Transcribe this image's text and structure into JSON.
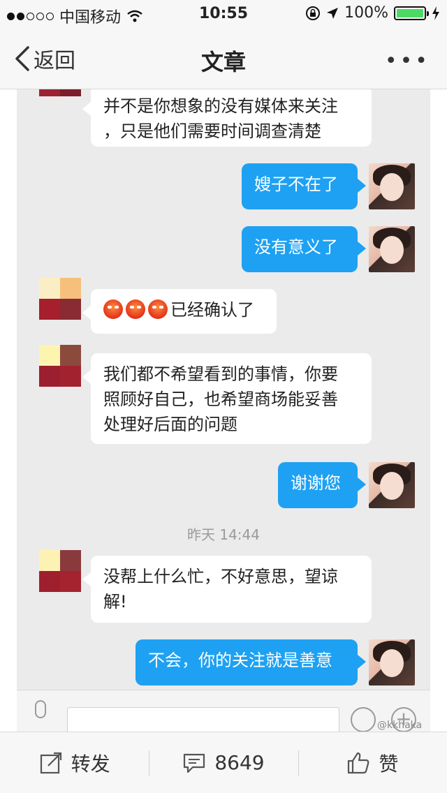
{
  "status_bar": {
    "carrier": "中国移动",
    "time": "10:55",
    "battery": "100%",
    "battery_color": "#4cd964"
  },
  "nav": {
    "back_label": "返回",
    "title": "文章",
    "more_label": "•••"
  },
  "chat": {
    "messages": [
      {
        "side": "in",
        "text": "并不是你想象的没有媒体来关注\n，只是他们需要时间调查清楚"
      },
      {
        "side": "out",
        "text": "嫂子不在了"
      },
      {
        "side": "out",
        "text": "没有意义了"
      },
      {
        "side": "in",
        "text": "已经确认了",
        "emoji_count": 3
      },
      {
        "side": "in",
        "text": "我们都不希望看到的事情，你要\n照顾好自己，也希望商场能妥善\n处理好后面的问题"
      },
      {
        "side": "out",
        "text": "谢谢您"
      },
      {
        "side": "in",
        "text": "没帮上什么忙，不好意思，望谅\n解!"
      },
      {
        "side": "out",
        "text": "不会，你的关注就是善意"
      }
    ],
    "timestamp": "昨天 14:44",
    "outgoing_color": "#1ea1f2"
  },
  "input_bar": {
    "watermark": "@kkhaka"
  },
  "toolbar": {
    "repost_label": "转发",
    "comment_count": "8649",
    "like_label": "赞"
  }
}
